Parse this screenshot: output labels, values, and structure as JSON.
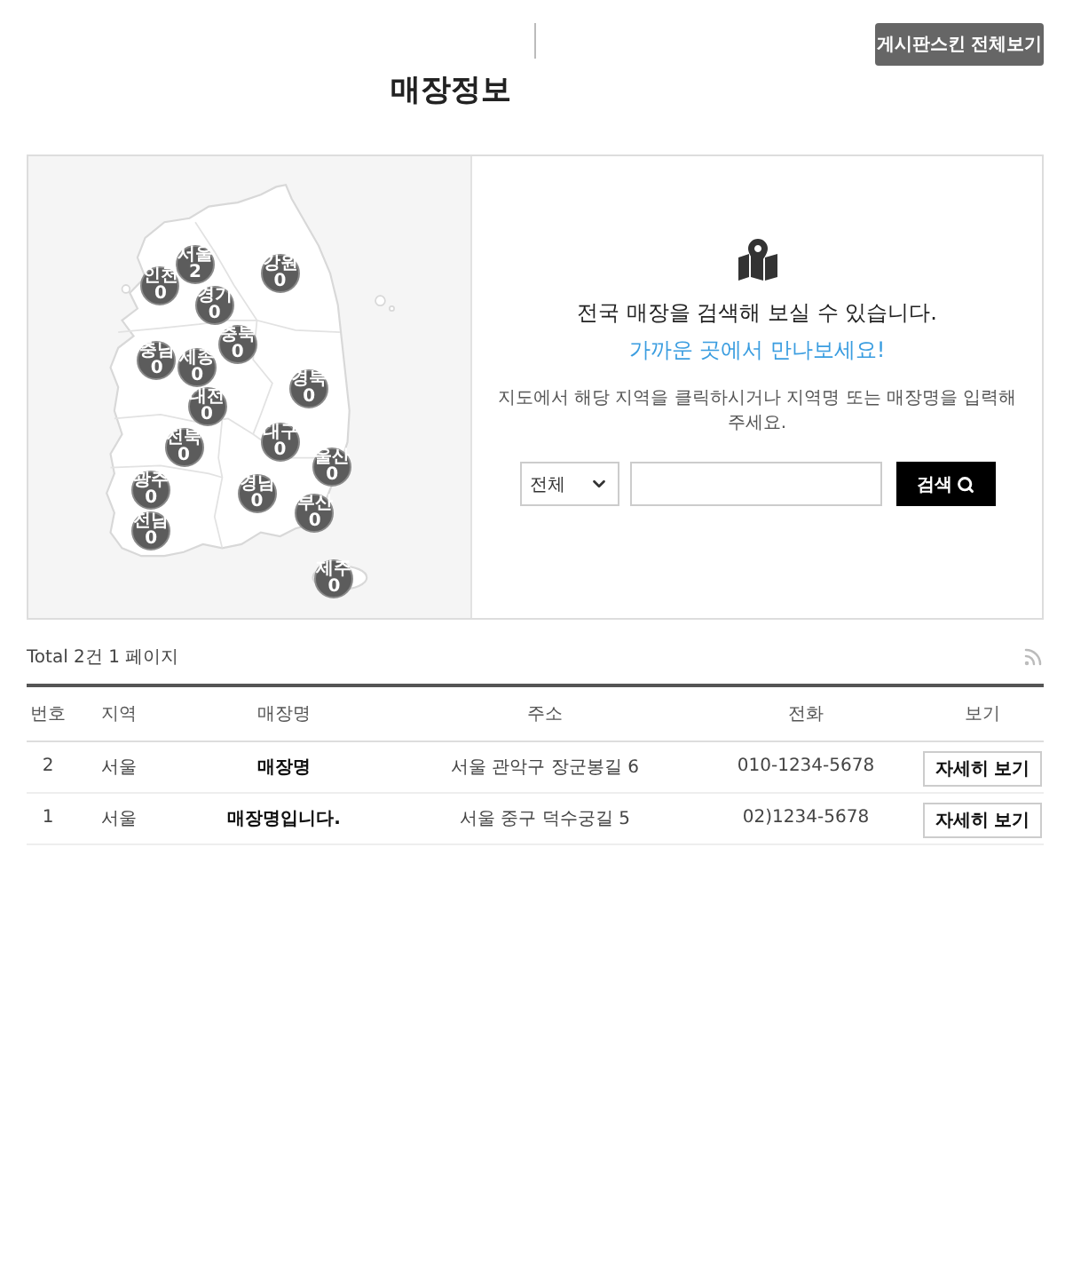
{
  "header": {
    "button": "게시판스킨 전체보기"
  },
  "page_title": "매장정보",
  "map": {
    "regions": [
      {
        "name": "서울",
        "count": "2"
      },
      {
        "name": "인천",
        "count": "0"
      },
      {
        "name": "강원",
        "count": "0"
      },
      {
        "name": "경기",
        "count": "0"
      },
      {
        "name": "충북",
        "count": "0"
      },
      {
        "name": "충남",
        "count": "0"
      },
      {
        "name": "세종",
        "count": "0"
      },
      {
        "name": "경북",
        "count": "0"
      },
      {
        "name": "대전",
        "count": "0"
      },
      {
        "name": "대구",
        "count": "0"
      },
      {
        "name": "전북",
        "count": "0"
      },
      {
        "name": "울산",
        "count": "0"
      },
      {
        "name": "경남",
        "count": "0"
      },
      {
        "name": "광주",
        "count": "0"
      },
      {
        "name": "부산",
        "count": "0"
      },
      {
        "name": "전남",
        "count": "0"
      },
      {
        "name": "제주",
        "count": "0"
      }
    ]
  },
  "search": {
    "headline": "전국 매장을 검색해 보실 수 있습니다.",
    "tagline": "가까운 곳에서 만나보세요!",
    "hint": "지도에서 해당 지역을 클릭하시거나 지역명 또는 매장명을 입력해 주세요.",
    "region_select": {
      "value": "전체"
    },
    "button": "검색"
  },
  "list": {
    "summary": "Total 2건 1 페이지",
    "columns": [
      "번호",
      "지역",
      "매장명",
      "주소",
      "전화",
      "보기"
    ],
    "rows": [
      {
        "number": "2",
        "region": "서울",
        "store": "매장명",
        "address": "서울 관악구 장군봉길 6",
        "phone": "010-1234-5678",
        "action": "자세히 보기"
      },
      {
        "number": "1",
        "region": "서울",
        "store": "매장명입니다.",
        "address": "서울 중구 덕수궁길 5",
        "phone": "02)1234-5678",
        "action": "자세히 보기"
      }
    ]
  }
}
